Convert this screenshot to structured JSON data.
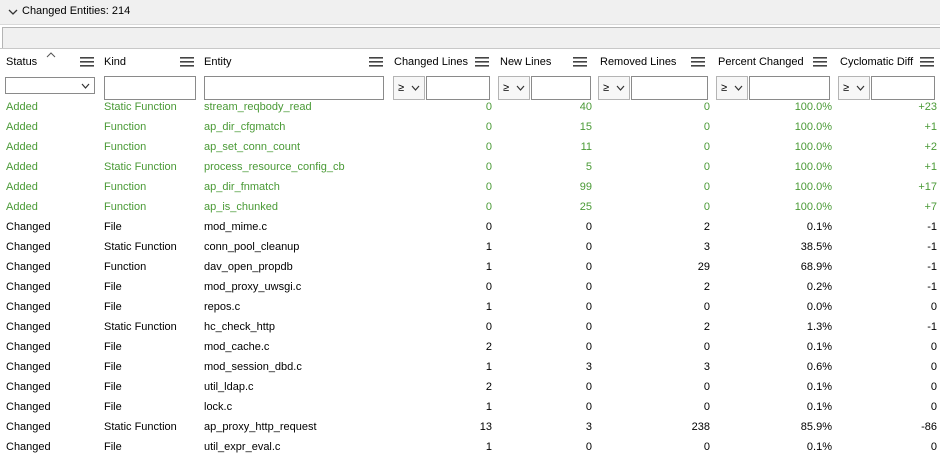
{
  "panel": {
    "title": "Changed Entities: 214"
  },
  "columns": [
    {
      "key": "status",
      "label": "Status"
    },
    {
      "key": "kind",
      "label": "Kind"
    },
    {
      "key": "entity",
      "label": "Entity"
    },
    {
      "key": "changed",
      "label": "Changed Lines"
    },
    {
      "key": "new",
      "label": "New Lines"
    },
    {
      "key": "removed",
      "label": "Removed Lines"
    },
    {
      "key": "percent",
      "label": "Percent Changed"
    },
    {
      "key": "cyclo",
      "label": "Cyclomatic Diff"
    }
  ],
  "filters": {
    "operator": "≥"
  },
  "colors": {
    "added": "#4a9a36",
    "changed": "#000000"
  },
  "rows": [
    {
      "status": "Added",
      "kind": "Static Function",
      "entity": "stream_reqbody_read",
      "changed": "0",
      "new": "40",
      "removed": "0",
      "percent": "100.0%",
      "cyclo": "+23"
    },
    {
      "status": "Added",
      "kind": "Function",
      "entity": "ap_dir_cfgmatch",
      "changed": "0",
      "new": "15",
      "removed": "0",
      "percent": "100.0%",
      "cyclo": "+1"
    },
    {
      "status": "Added",
      "kind": "Function",
      "entity": "ap_set_conn_count",
      "changed": "0",
      "new": "11",
      "removed": "0",
      "percent": "100.0%",
      "cyclo": "+2"
    },
    {
      "status": "Added",
      "kind": "Static Function",
      "entity": "process_resource_config_cb",
      "changed": "0",
      "new": "5",
      "removed": "0",
      "percent": "100.0%",
      "cyclo": "+1"
    },
    {
      "status": "Added",
      "kind": "Function",
      "entity": "ap_dir_fnmatch",
      "changed": "0",
      "new": "99",
      "removed": "0",
      "percent": "100.0%",
      "cyclo": "+17"
    },
    {
      "status": "Added",
      "kind": "Function",
      "entity": "ap_is_chunked",
      "changed": "0",
      "new": "25",
      "removed": "0",
      "percent": "100.0%",
      "cyclo": "+7"
    },
    {
      "status": "Changed",
      "kind": "File",
      "entity": "mod_mime.c",
      "changed": "0",
      "new": "0",
      "removed": "2",
      "percent": "0.1%",
      "cyclo": "-1"
    },
    {
      "status": "Changed",
      "kind": "Static Function",
      "entity": "conn_pool_cleanup",
      "changed": "1",
      "new": "0",
      "removed": "3",
      "percent": "38.5%",
      "cyclo": "-1"
    },
    {
      "status": "Changed",
      "kind": "Function",
      "entity": "dav_open_propdb",
      "changed": "1",
      "new": "0",
      "removed": "29",
      "percent": "68.9%",
      "cyclo": "-1"
    },
    {
      "status": "Changed",
      "kind": "File",
      "entity": "mod_proxy_uwsgi.c",
      "changed": "0",
      "new": "0",
      "removed": "2",
      "percent": "0.2%",
      "cyclo": "-1"
    },
    {
      "status": "Changed",
      "kind": "File",
      "entity": "repos.c",
      "changed": "1",
      "new": "0",
      "removed": "0",
      "percent": "0.0%",
      "cyclo": "0"
    },
    {
      "status": "Changed",
      "kind": "Static Function",
      "entity": "hc_check_http",
      "changed": "0",
      "new": "0",
      "removed": "2",
      "percent": "1.3%",
      "cyclo": "-1"
    },
    {
      "status": "Changed",
      "kind": "File",
      "entity": "mod_cache.c",
      "changed": "2",
      "new": "0",
      "removed": "0",
      "percent": "0.1%",
      "cyclo": "0"
    },
    {
      "status": "Changed",
      "kind": "File",
      "entity": "mod_session_dbd.c",
      "changed": "1",
      "new": "3",
      "removed": "3",
      "percent": "0.6%",
      "cyclo": "0"
    },
    {
      "status": "Changed",
      "kind": "File",
      "entity": "util_ldap.c",
      "changed": "2",
      "new": "0",
      "removed": "0",
      "percent": "0.1%",
      "cyclo": "0"
    },
    {
      "status": "Changed",
      "kind": "File",
      "entity": "lock.c",
      "changed": "1",
      "new": "0",
      "removed": "0",
      "percent": "0.1%",
      "cyclo": "0"
    },
    {
      "status": "Changed",
      "kind": "Static Function",
      "entity": "ap_proxy_http_request",
      "changed": "13",
      "new": "3",
      "removed": "238",
      "percent": "85.9%",
      "cyclo": "-86"
    },
    {
      "status": "Changed",
      "kind": "File",
      "entity": "util_expr_eval.c",
      "changed": "1",
      "new": "0",
      "removed": "0",
      "percent": "0.1%",
      "cyclo": "0"
    }
  ]
}
